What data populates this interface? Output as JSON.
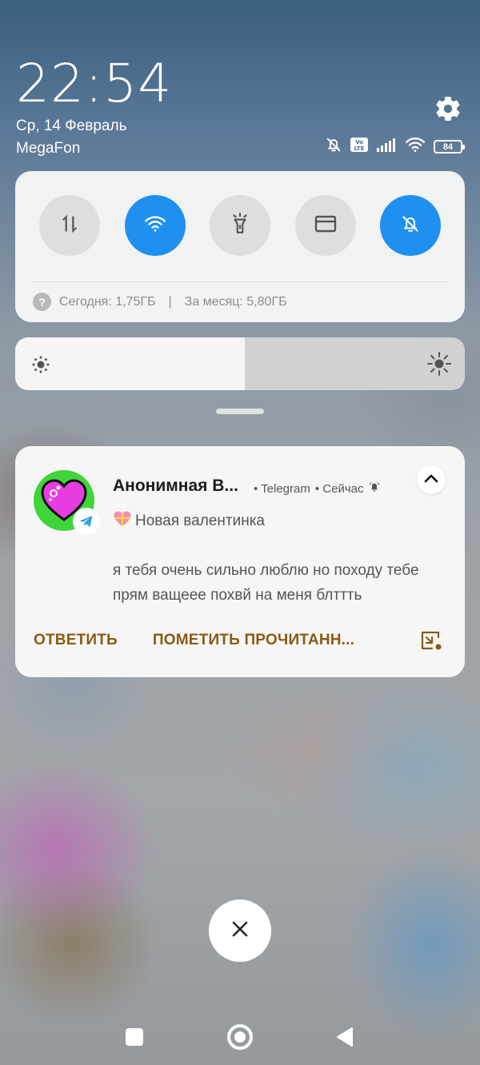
{
  "header": {
    "time": "22:54",
    "date": "Ср, 14 Февраль",
    "carrier": "MegaFon",
    "battery": "84",
    "volte": "Vo LTE"
  },
  "quick_settings": {
    "tiles": [
      {
        "icon": "mobile-data-icon",
        "active": false
      },
      {
        "icon": "wifi-icon",
        "active": true
      },
      {
        "icon": "flashlight-icon",
        "active": false
      },
      {
        "icon": "card-icon",
        "active": false
      },
      {
        "icon": "mute-icon",
        "active": true
      }
    ],
    "usage_today": "Сегодня: 1,75ГБ",
    "usage_separator": "|",
    "usage_month": "За месяц: 5,80ГБ"
  },
  "brightness": {
    "level": 0.51
  },
  "notification": {
    "title": "Анонимная В...",
    "app": "• Telegram",
    "time": "• Сейчас",
    "subtitle": "Новая валентинка",
    "body": "я тебя очень сильно люблю но походу тебе прям ващеее похвй на меня блттть",
    "actions": [
      "ОТВЕТИТЬ",
      "ПОМЕТИТЬ ПРОЧИТАНН..."
    ]
  },
  "colors": {
    "accent_blue": "#1e90f0",
    "action_brown": "#8a5a12",
    "avatar_green": "#3fd43a",
    "heart_magenta": "#e63ce0"
  }
}
